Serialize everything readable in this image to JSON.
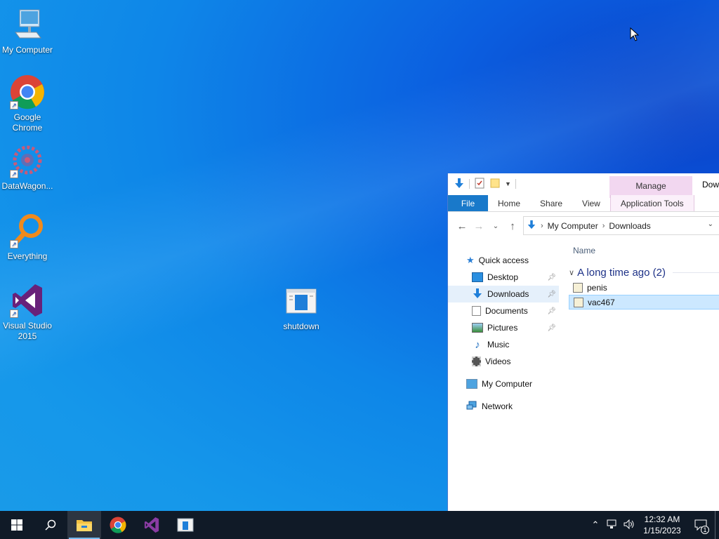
{
  "desktop": {
    "icons": [
      {
        "label": "My Computer",
        "icon": "computer-icon"
      },
      {
        "label": "Google Chrome",
        "icon": "chrome-icon"
      },
      {
        "label": "DataWagon...",
        "icon": "datawagon-icon"
      },
      {
        "label": "Everything",
        "icon": "everything-icon"
      },
      {
        "label": "Visual Studio 2015",
        "icon": "visual-studio-icon"
      },
      {
        "label": "shutdown",
        "icon": "shutdown-icon"
      }
    ]
  },
  "explorer": {
    "title_partial": "Dow",
    "manage_tab": "Manage",
    "ribbon_tabs": [
      "File",
      "Home",
      "Share",
      "View",
      "Application Tools"
    ],
    "address": {
      "root": "My Computer",
      "current": "Downloads"
    },
    "column_header": "Name",
    "nav": {
      "quick_access": "Quick access",
      "items": [
        {
          "label": "Desktop",
          "pinned": true
        },
        {
          "label": "Downloads",
          "pinned": true,
          "selected": true
        },
        {
          "label": "Documents",
          "pinned": true
        },
        {
          "label": "Pictures",
          "pinned": true
        },
        {
          "label": "Music",
          "pinned": false
        },
        {
          "label": "Videos",
          "pinned": false
        }
      ],
      "my_computer": "My Computer",
      "network": "Network"
    },
    "group": {
      "label": "A long time ago (2)"
    },
    "files": [
      {
        "name": "penis",
        "selected": false
      },
      {
        "name": "vac467",
        "selected": true
      }
    ]
  },
  "taskbar": {
    "clock_time": "12:32 AM",
    "clock_date": "1/15/2023",
    "notification_count": "1",
    "pinned": [
      "file-explorer",
      "chrome",
      "visual-studio",
      "shutdown-app"
    ],
    "active": "file-explorer"
  },
  "colors": {
    "taskbar": "#101a27",
    "file_tab": "#1979ca",
    "manage_tab": "#f2d7f0",
    "selection": "#cce8ff"
  }
}
